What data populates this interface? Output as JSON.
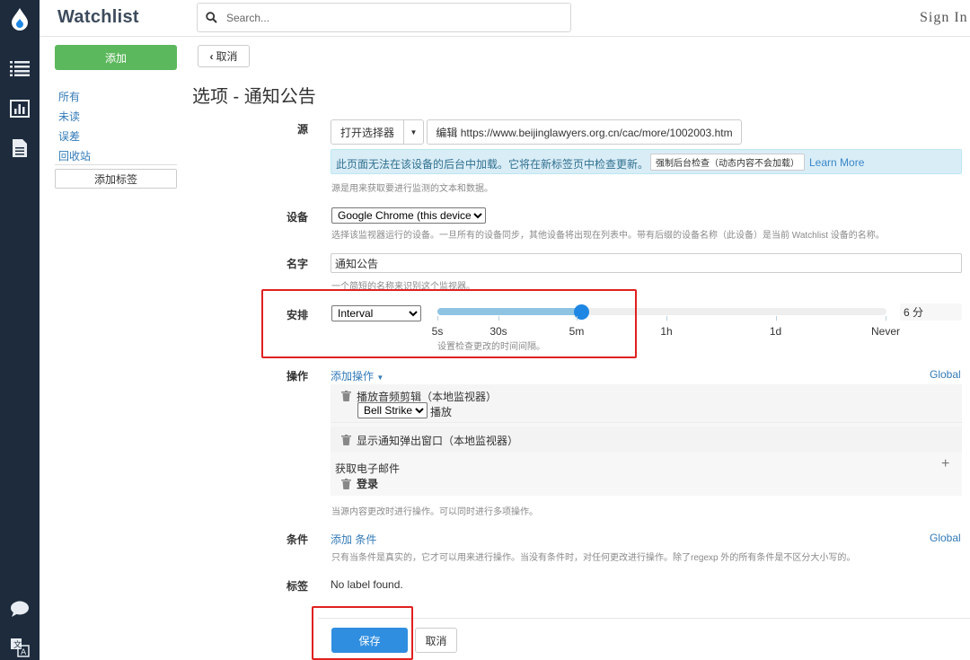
{
  "app": {
    "title": "Watchlist",
    "sign_in": "Sign In"
  },
  "search": {
    "placeholder": "Search..."
  },
  "rail": {
    "icons": [
      "droplet-logo-icon",
      "list-icon",
      "chart-icon",
      "document-icon",
      "chat-icon",
      "translate-icon"
    ]
  },
  "sidebar": {
    "add_label": "添加",
    "items": [
      {
        "label": "所有"
      },
      {
        "label": "未读"
      },
      {
        "label": "误差"
      },
      {
        "label": "回收站"
      }
    ],
    "add_tag_label": "添加标签"
  },
  "main": {
    "cancel_label": "取消",
    "title": "选项 - 通知公告",
    "source": {
      "label": "源",
      "picker_label": "打开选择器",
      "edit_label": "编辑 https://www.beijinglawyers.org.cn/cac/more/1002003.htm",
      "alert_text": "此页面无法在该设备的后台中加载。它将在新标签页中检查更新。",
      "force_label": "强制后台检查（动态内容不会加载）",
      "learn_more": "Learn More",
      "help": "源是用来获取要进行监测的文本和数据。"
    },
    "device": {
      "label": "设备",
      "selected": "Google Chrome (this device)",
      "help": "选择该监视器运行的设备。一旦所有的设备同步，其他设备将出现在列表中。带有后缀的设备名称（此设备）是当前 Watchlist 设备的名称。"
    },
    "name": {
      "label": "名字",
      "value": "通知公告",
      "help": "一个简短的名称来识别这个监视器。"
    },
    "schedule": {
      "label": "安排",
      "mode": "Interval",
      "ticks": [
        "5s",
        "30s",
        "5m",
        "1h",
        "1d",
        "Never"
      ],
      "level": 0.32,
      "value_text": "6 分",
      "help": "设置检查更改的时间间隔。"
    },
    "actions": {
      "label": "操作",
      "add_label": "添加操作",
      "global": "Global",
      "items": [
        {
          "text": "播放音频剪辑（本地监视器）",
          "sound": "Bell Strike",
          "play": "播放"
        },
        {
          "text": "显示通知弹出窗口（本地监视器）"
        }
      ],
      "email_title": "获取电子邮件",
      "login": "登录",
      "help": "当源内容更改时进行操作。可以同时进行多项操作。"
    },
    "conditions": {
      "label": "条件",
      "add_label": "添加 条件",
      "global": "Global",
      "help": "只有当条件是真实的，它才可以用来进行操作。当没有条件时，对任何更改进行操作。除了regexp 外的所有条件是不区分大小写的。"
    },
    "tags": {
      "label": "标签",
      "empty": "No label found."
    },
    "footer": {
      "save": "保存",
      "cancel": "取消"
    }
  },
  "colors": {
    "rail": "#1d2b3d",
    "accent_blue": "#2f8ee0",
    "add_green": "#5cb85c",
    "highlight_red": "#e02020"
  }
}
